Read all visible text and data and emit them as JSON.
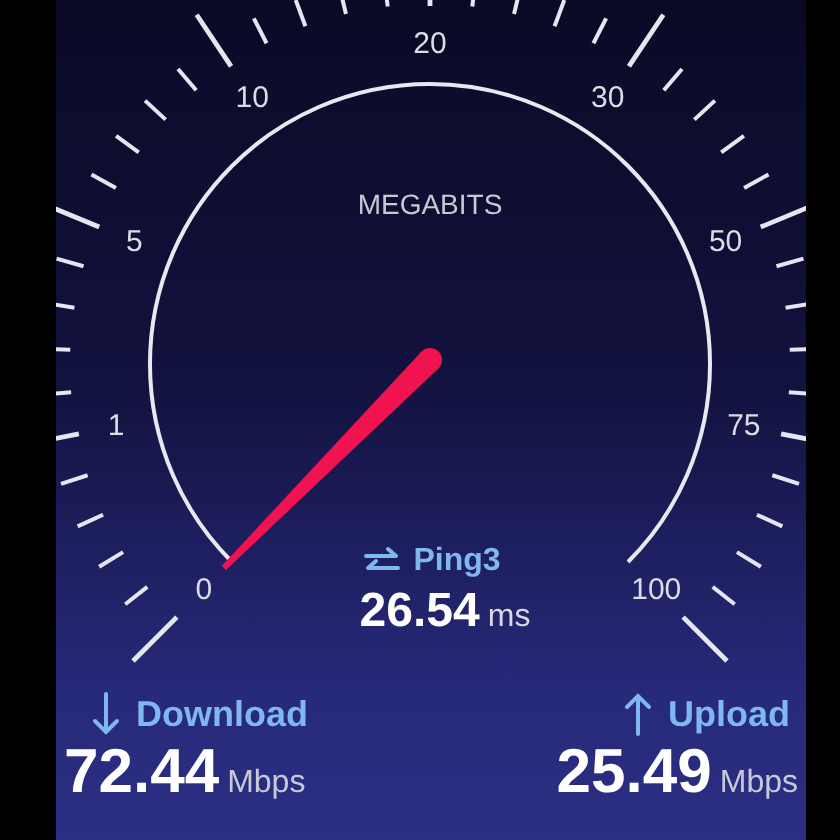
{
  "gauge": {
    "unit_label": "MEGABITS",
    "scale_labels": [
      "0",
      "1",
      "5",
      "10",
      "20",
      "30",
      "50",
      "75",
      "100"
    ]
  },
  "ping": {
    "label": "Ping3",
    "value": "26.54",
    "unit": "ms"
  },
  "results": [
    {
      "kind": "download",
      "label": "Download",
      "value": "72.44",
      "unit": "Mbps"
    },
    {
      "kind": "upload",
      "label": "Upload",
      "value": "25.49",
      "unit": "Mbps"
    }
  ]
}
